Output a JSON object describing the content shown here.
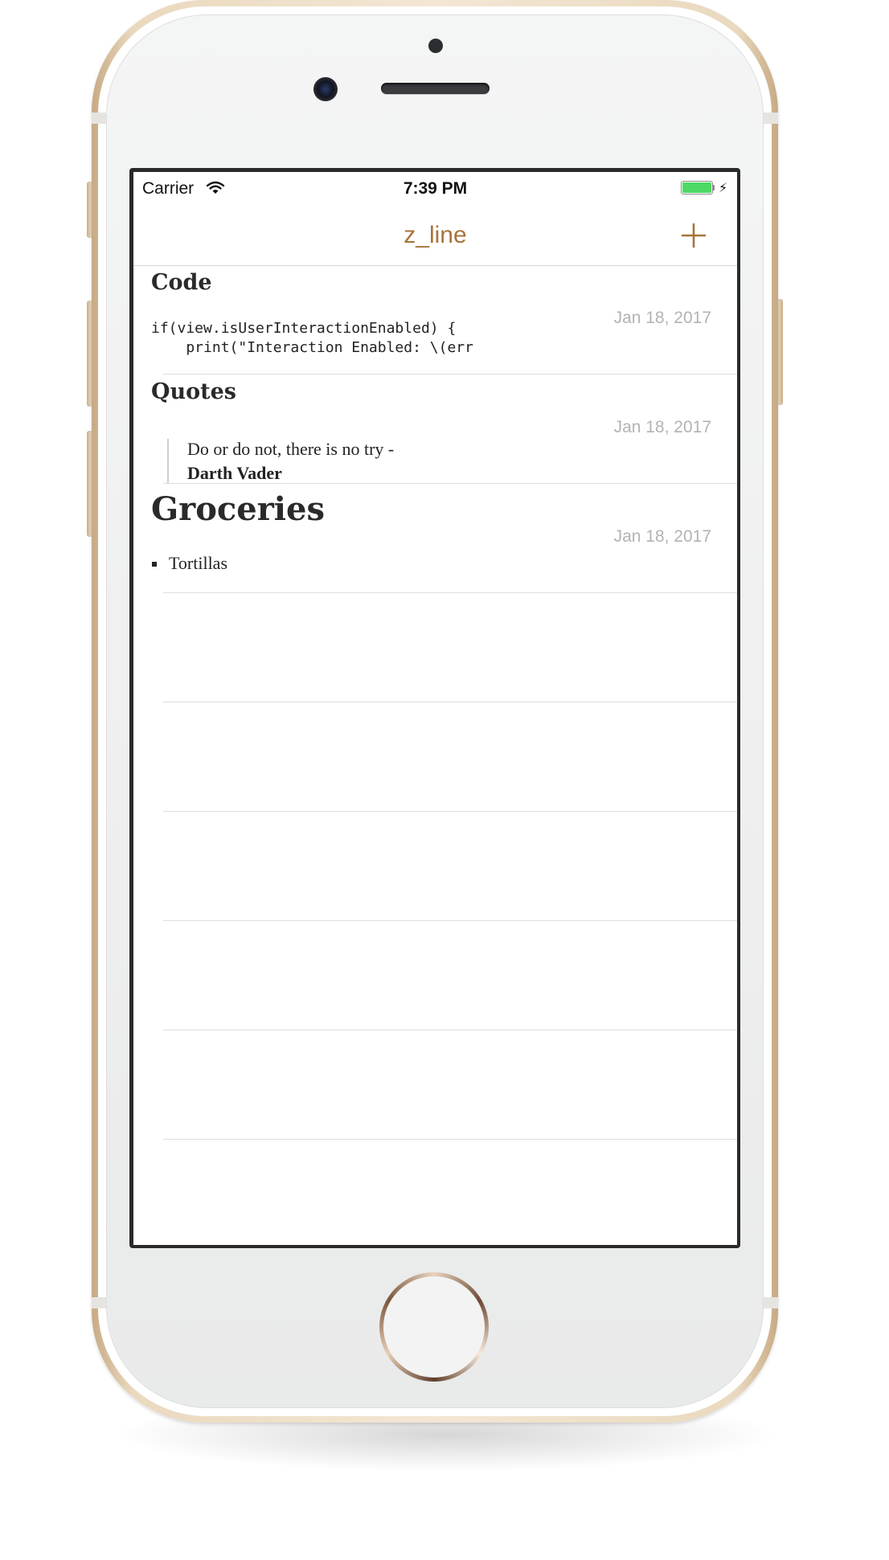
{
  "status_bar": {
    "carrier": "Carrier",
    "time": "7:39 PM",
    "battery_level": 1.0,
    "wifi_icon": "wifi-icon",
    "charging_icon": "bolt-icon"
  },
  "nav": {
    "title": "z_line",
    "add_icon": "plus-icon",
    "accent_color": "#a8733a"
  },
  "notes": [
    {
      "title": "Code",
      "date": "Jan 18, 2017",
      "code_lines": [
        "if(view.isUserInteractionEnabled) {",
        "    print(\"Interaction Enabled: \\(err"
      ]
    },
    {
      "title": "Quotes",
      "date": "Jan 18, 2017",
      "quote": "Do or do not, there is no try -",
      "author": "Darth Vader"
    },
    {
      "title": "Groceries",
      "date": "Jan 18, 2017",
      "items": [
        "Tortillas"
      ]
    }
  ]
}
